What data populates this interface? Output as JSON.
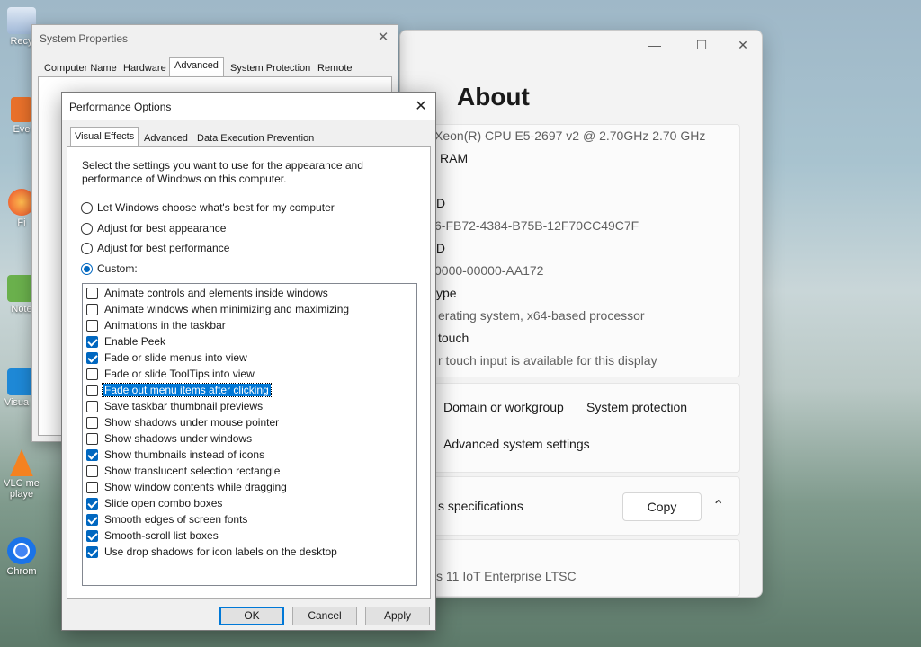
{
  "desktop": {
    "icons": [
      {
        "label": "Recy",
        "icon": "recycle-bin-icon"
      },
      {
        "label": "Eve",
        "icon": "everything-icon"
      },
      {
        "label": "Fi",
        "icon": "firefox-icon"
      },
      {
        "label": "Note",
        "icon": "notepad-icon"
      },
      {
        "label": "Visua C",
        "icon": "vscode-icon"
      },
      {
        "label": "VLC me playe",
        "icon": "vlc-icon"
      },
      {
        "label": "Chrom",
        "icon": "chrome-icon"
      }
    ]
  },
  "settings": {
    "page_title": "About",
    "controls": {
      "minimize": "—",
      "maximize": "☐",
      "close": "✕"
    },
    "specs": [
      {
        "value": "Xeon(R) CPU E5-2697 v2 @ 2.70GHz   2.70 GHz"
      },
      {
        "label": "RAM"
      },
      {
        "label": "D"
      },
      {
        "value": "6-FB72-4384-B75B-12F70CC49C7F"
      },
      {
        "label": "ID"
      },
      {
        "value": "0000-00000-AA172"
      },
      {
        "label": "ype"
      },
      {
        "value": "erating system, x64-based processor"
      },
      {
        "label": "touch"
      },
      {
        "value": "r touch input is available for this display"
      }
    ],
    "links": {
      "domain": "Domain or workgroup",
      "protection": "System protection",
      "advanced": "Advanced system settings"
    },
    "win_specs_label": "s specifications",
    "copy_label": "Copy",
    "edition_partial": "s 11 IoT Enterprise LTSC"
  },
  "sysprops": {
    "title": "System Properties",
    "tabs": [
      "Computer Name",
      "Hardware",
      "Advanced",
      "System Protection",
      "Remote"
    ],
    "active_tab": "Advanced",
    "close": "✕"
  },
  "perf": {
    "title": "Performance Options",
    "close": "✕",
    "tabs": [
      "Visual Effects",
      "Advanced",
      "Data Execution Prevention"
    ],
    "description": "Select the settings you want to use for the appearance and performance of Windows on this computer.",
    "radios": [
      {
        "label": "Let Windows choose what's best for my computer",
        "checked": false
      },
      {
        "label": "Adjust for best appearance",
        "checked": false
      },
      {
        "label": "Adjust for best performance",
        "checked": false
      },
      {
        "label": "Custom:",
        "checked": true
      }
    ],
    "items": [
      {
        "label": "Animate controls and elements inside windows",
        "checked": false
      },
      {
        "label": "Animate windows when minimizing and maximizing",
        "checked": false
      },
      {
        "label": "Animations in the taskbar",
        "checked": false
      },
      {
        "label": "Enable Peek",
        "checked": true
      },
      {
        "label": "Fade or slide menus into view",
        "checked": true
      },
      {
        "label": "Fade or slide ToolTips into view",
        "checked": false
      },
      {
        "label": "Fade out menu items after clicking",
        "checked": false,
        "selected": true
      },
      {
        "label": "Save taskbar thumbnail previews",
        "checked": false
      },
      {
        "label": "Show shadows under mouse pointer",
        "checked": false
      },
      {
        "label": "Show shadows under windows",
        "checked": false
      },
      {
        "label": "Show thumbnails instead of icons",
        "checked": true
      },
      {
        "label": "Show translucent selection rectangle",
        "checked": false
      },
      {
        "label": "Show window contents while dragging",
        "checked": false
      },
      {
        "label": "Slide open combo boxes",
        "checked": true
      },
      {
        "label": "Smooth edges of screen fonts",
        "checked": true
      },
      {
        "label": "Smooth-scroll list boxes",
        "checked": true
      },
      {
        "label": "Use drop shadows for icon labels on the desktop",
        "checked": true
      }
    ],
    "buttons": {
      "ok": "OK",
      "cancel": "Cancel",
      "apply": "Apply"
    }
  }
}
